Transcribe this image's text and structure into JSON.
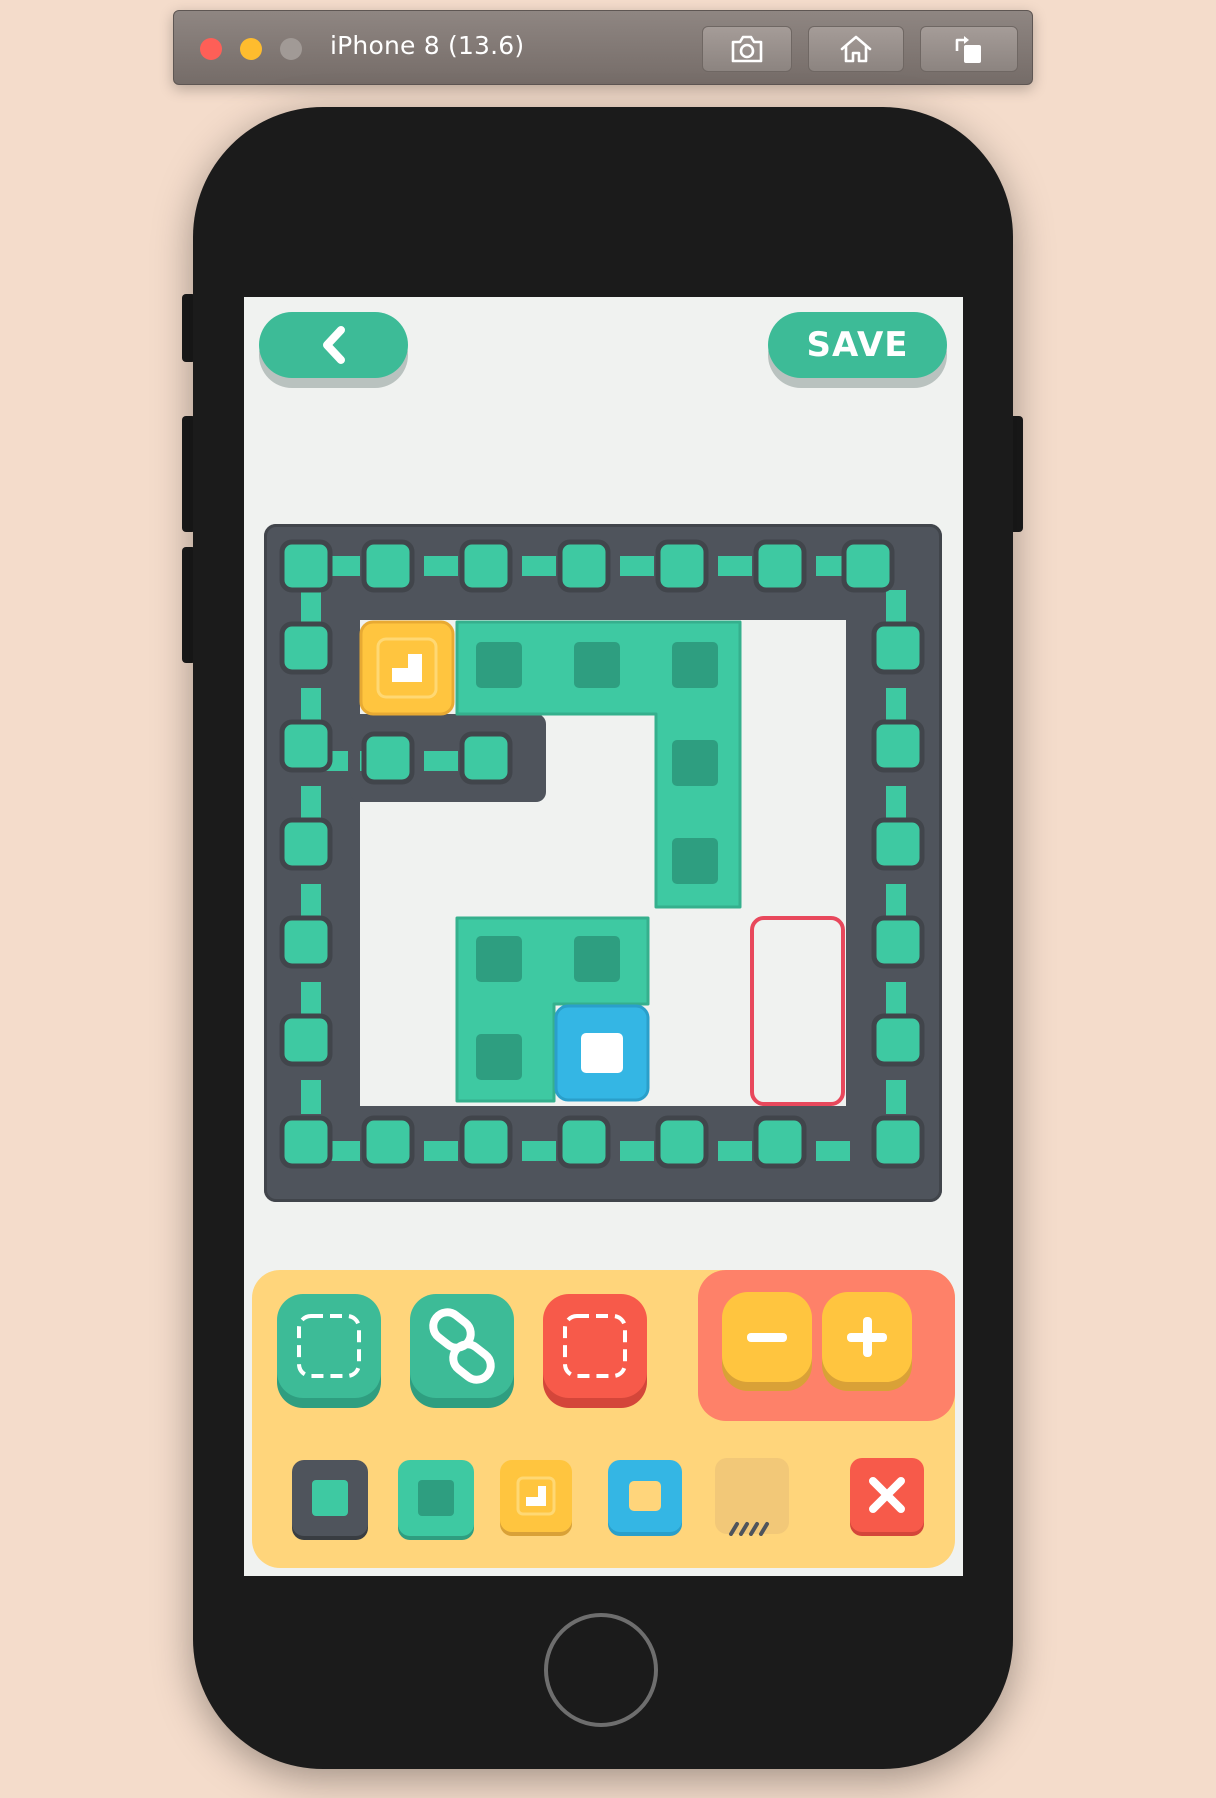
{
  "window": {
    "title": "iPhone 8 (13.6)",
    "toolbar_buttons": [
      "camera-icon",
      "home-icon",
      "rotate-icon"
    ]
  },
  "app": {
    "header": {
      "back_icon": "chevron-left-icon",
      "save_label": "SAVE"
    },
    "board": {
      "columns": 7,
      "rows": 7,
      "pieces": [
        {
          "type": "target",
          "color": "#ffc53f",
          "icon": "corner-marker-icon"
        },
        {
          "type": "block",
          "color": "#3ec9a2",
          "shape": "L-shape"
        },
        {
          "type": "block",
          "color": "#3ec9a2",
          "shape": "L-shape"
        },
        {
          "type": "player",
          "color": "#34b6e4"
        },
        {
          "type": "selection",
          "color": "#e8485c"
        }
      ]
    },
    "tools": [
      {
        "name": "select-block-tool",
        "icon": "dashed-square-icon",
        "color": "#3dbb97"
      },
      {
        "name": "link-tool",
        "icon": "chain-link-icon",
        "color": "#3dbb97"
      },
      {
        "name": "erase-area-tool",
        "icon": "dashed-square-icon",
        "color": "#f75a4a"
      }
    ],
    "size_controls": [
      {
        "name": "decrease",
        "icon": "minus-icon"
      },
      {
        "name": "increase",
        "icon": "plus-icon"
      }
    ],
    "palette": [
      {
        "name": "wall-tile",
        "color": "#4f545c"
      },
      {
        "name": "block-tile",
        "color": "#3ec9a2"
      },
      {
        "name": "goal-tile",
        "color": "#ffc53f"
      },
      {
        "name": "player-tile",
        "color": "#34b6e4"
      },
      {
        "name": "empty-tile",
        "color": "#f2c878"
      },
      {
        "name": "delete-tile",
        "color": "#f75a4a",
        "icon": "close-icon"
      }
    ]
  }
}
